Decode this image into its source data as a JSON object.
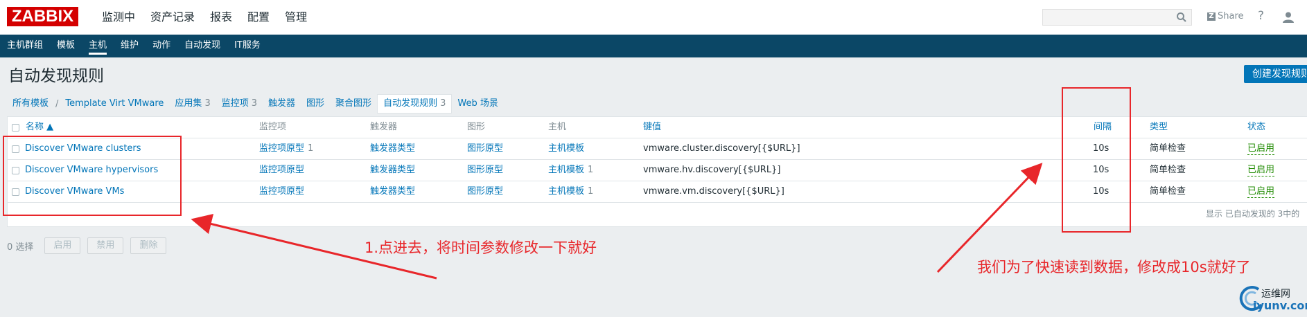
{
  "header": {
    "logo": "ZABBIX",
    "menu": [
      "监测中",
      "资产记录",
      "报表",
      "配置",
      "管理"
    ],
    "active_menu": "配置",
    "search_value": "",
    "share_label": "Share",
    "help_label": "?"
  },
  "submenu": {
    "items": [
      "主机群组",
      "模板",
      "主机",
      "维护",
      "动作",
      "自动发现",
      "IT服务"
    ],
    "active": "主机"
  },
  "page": {
    "title": "自动发现规则",
    "create_button": "创建发现规则"
  },
  "breadcrumb": {
    "all_templates": "所有模板",
    "separator": "/",
    "template": "Template Virt VMware",
    "tabs": [
      {
        "label": "应用集",
        "count": "3"
      },
      {
        "label": "监控项",
        "count": "3"
      },
      {
        "label": "触发器",
        "count": ""
      },
      {
        "label": "图形",
        "count": ""
      },
      {
        "label": "聚合图形",
        "count": ""
      },
      {
        "label": "自动发现规则",
        "count": "3"
      },
      {
        "label": "Web 场景",
        "count": ""
      }
    ]
  },
  "table": {
    "headers": {
      "name": "名称 ▲",
      "items": "监控项",
      "triggers": "触发器",
      "graphs": "图形",
      "hosts": "主机",
      "key": "键值",
      "interval": "间隔",
      "type": "类型",
      "status": "状态"
    },
    "rows": [
      {
        "name": "Discover VMware clusters",
        "items": "监控项原型",
        "items_count": "1",
        "triggers": "触发器类型",
        "graphs": "图形原型",
        "hosts": "主机模板",
        "hosts_count": "",
        "key": "vmware.cluster.discovery[{$URL}]",
        "interval": "10s",
        "type": "简单检查",
        "status": "已启用"
      },
      {
        "name": "Discover VMware hypervisors",
        "items": "监控项原型",
        "items_count": "",
        "triggers": "触发器类型",
        "graphs": "图形原型",
        "hosts": "主机模板",
        "hosts_count": "1",
        "key": "vmware.hv.discovery[{$URL}]",
        "interval": "10s",
        "type": "简单检查",
        "status": "已启用"
      },
      {
        "name": "Discover VMware VMs",
        "items": "监控项原型",
        "items_count": "",
        "triggers": "触发器类型",
        "graphs": "图形原型",
        "hosts": "主机模板",
        "hosts_count": "1",
        "key": "vmware.vm.discovery[{$URL}]",
        "interval": "10s",
        "type": "简单检查",
        "status": "已启用"
      }
    ],
    "footer": "显示 已自动发现的 3中的"
  },
  "actions": {
    "selected": "0 选择",
    "enable": "启用",
    "disable": "禁用",
    "delete": "删除"
  },
  "annotations": {
    "left": "1.点进去，将时间参数修改一下就好",
    "right": "我们为了快速读到数据，修改成10s就好了",
    "color": "#e8262a"
  },
  "watermark": {
    "line1": "运维网",
    "line2": "iyunv.com"
  }
}
